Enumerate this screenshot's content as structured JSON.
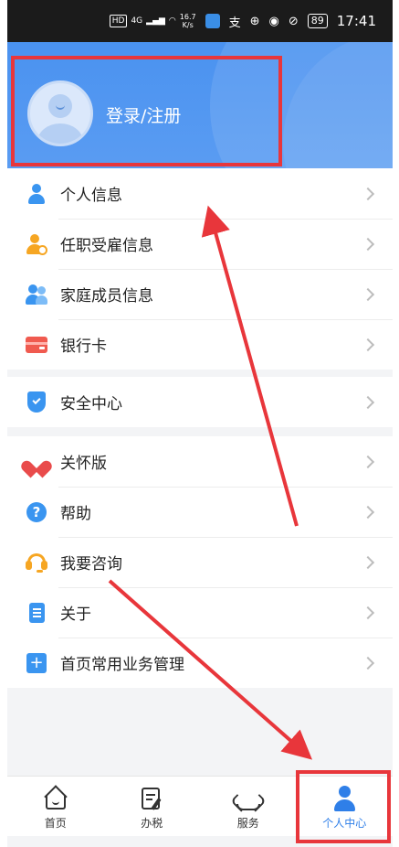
{
  "status_bar": {
    "hd": "HD",
    "network": "4G",
    "speed_value": "16.7",
    "speed_unit": "K/s",
    "extra_icon_char": "支",
    "battery": "89",
    "time": "17:41"
  },
  "header": {
    "login_label": "登录/注册"
  },
  "menu": {
    "group1": [
      {
        "label": "个人信息",
        "icon": "person-icon"
      },
      {
        "label": "任职受雇信息",
        "icon": "employment-icon"
      },
      {
        "label": "家庭成员信息",
        "icon": "family-icon"
      },
      {
        "label": "银行卡",
        "icon": "bank-card-icon"
      }
    ],
    "group2": [
      {
        "label": "安全中心",
        "icon": "shield-icon"
      }
    ],
    "group3": [
      {
        "label": "关怀版",
        "icon": "heart-icon"
      },
      {
        "label": "帮助",
        "icon": "help-icon"
      },
      {
        "label": "我要咨询",
        "icon": "headset-icon"
      },
      {
        "label": "关于",
        "icon": "document-icon"
      },
      {
        "label": "首页常用业务管理",
        "icon": "plus-icon"
      }
    ]
  },
  "help_glyph": "?",
  "plus_glyph": "+",
  "tabs": [
    {
      "label": "首页",
      "icon": "home-icon"
    },
    {
      "label": "办税",
      "icon": "tax-icon"
    },
    {
      "label": "服务",
      "icon": "service-icon"
    },
    {
      "label": "个人中心",
      "icon": "profile-icon",
      "active": true
    }
  ],
  "colors": {
    "header_blue": "#4a92f0",
    "accent_blue": "#2f7fe8",
    "annotation_red": "#e8363b"
  }
}
